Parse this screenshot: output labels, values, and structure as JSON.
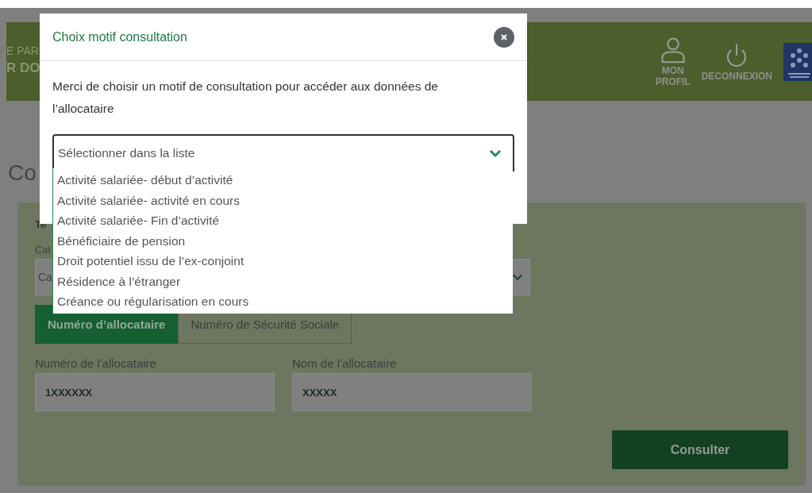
{
  "header": {
    "partial_lines": [
      "E PAR",
      "R DO"
    ],
    "actions": [
      {
        "kind": "profile",
        "label": "MON PROFIL"
      },
      {
        "kind": "power",
        "label": "DECONNEXION"
      }
    ]
  },
  "page": {
    "heading_partial": "Co",
    "form": {
      "section_partial": "Te",
      "label_partial": "Cat",
      "select_partial": "Ca",
      "tabs": [
        {
          "label": "Numéro d’allocataire",
          "selected": true
        },
        {
          "label": "Numéro de Sécurité Sociale",
          "selected": false
        }
      ],
      "fields": [
        {
          "label": "Numéro de l'allocataire",
          "value": "1XXXXXX"
        },
        {
          "label": "Nom de l'allocataire",
          "value": "XXXXX"
        }
      ],
      "submit": "Consulter"
    }
  },
  "modal": {
    "title": "Choix motif consultation",
    "message": "Merci de choisir un motif de consultation pour accéder aux données de l’allocataire",
    "select": {
      "placeholder": "Sélectionner dans la liste",
      "expanded": true
    },
    "options": [
      "Activité salariée- début d’activité",
      "Activité salariée- activité en cours",
      "Activité salariée- Fin d’activité",
      "Bénéficiaire de pension",
      "Droit potentiel issu de l’ex-conjoint",
      "Résidence à l’étranger",
      "Créance ou régularisation en cours"
    ]
  }
}
